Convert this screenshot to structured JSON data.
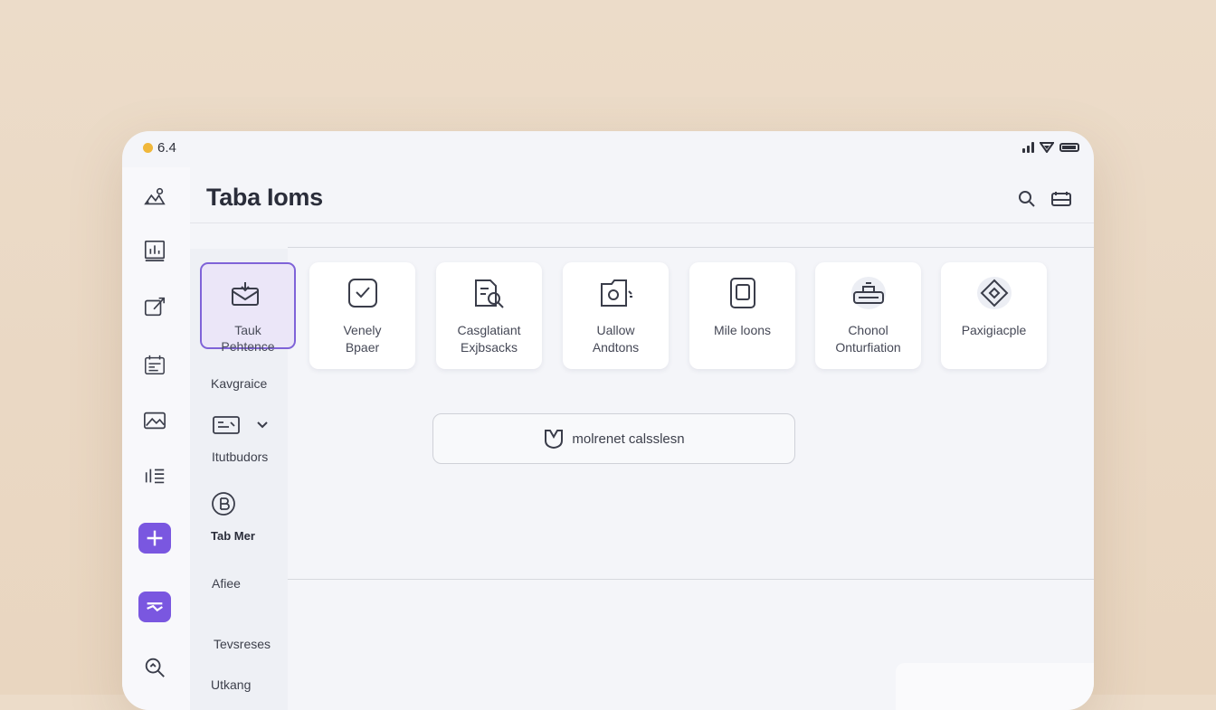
{
  "status_bar": {
    "time": "6.4"
  },
  "header": {
    "title": "Taba Ioms"
  },
  "sidebar": {
    "selected_card": {
      "line1": "Tauk",
      "line2": "Pehtence"
    },
    "items": [
      {
        "label": "Kavgraice"
      },
      {
        "label": "Itutbudors"
      },
      {
        "label": "Tab Mer"
      },
      {
        "label": "Afiee"
      },
      {
        "label": "Tevsreses"
      },
      {
        "label": "Utkang"
      }
    ]
  },
  "tiles": [
    {
      "line1": "Venely",
      "line2": "Bpaer",
      "icon": "check-square-icon"
    },
    {
      "line1": "Casglatiant",
      "line2": "Exjbsacks",
      "icon": "document-edit-icon"
    },
    {
      "line1": "Uallow",
      "line2": "Andtons",
      "icon": "folder-icon"
    },
    {
      "line1": "Mile loons",
      "line2": "",
      "icon": "tablet-icon"
    },
    {
      "line1": "Chonol",
      "line2": "Onturfiation",
      "icon": "keyboard-icon"
    },
    {
      "line1": "Paxigiacple",
      "line2": "",
      "icon": "diamond-icon"
    }
  ],
  "action_button": {
    "label": "molrenet calsslesn",
    "icon": "shield-icon"
  },
  "colors": {
    "accent": "#7a57e0",
    "status_dot": "#f0b73a"
  }
}
